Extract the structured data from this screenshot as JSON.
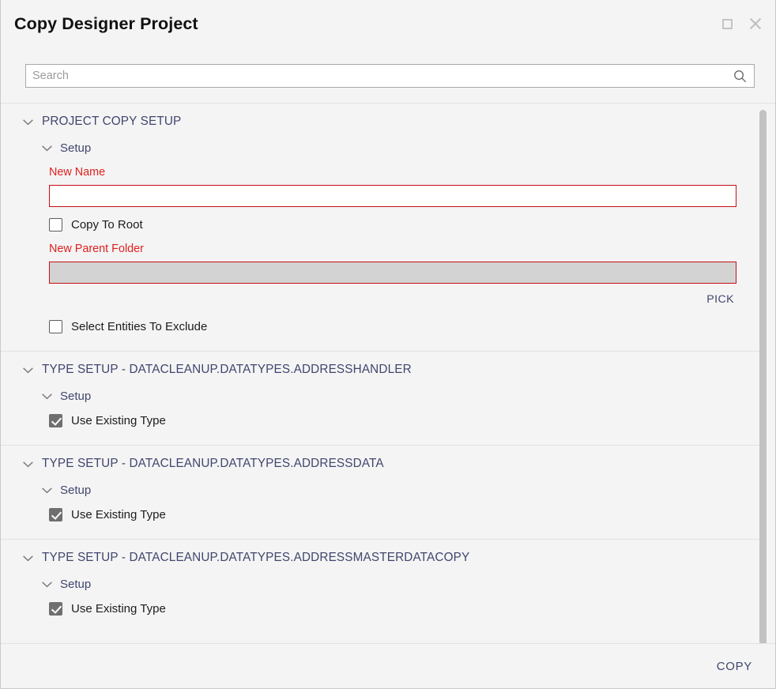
{
  "window": {
    "title": "Copy Designer Project",
    "maximize_icon": "maximize-square-icon",
    "close_icon": "close-x-icon"
  },
  "search": {
    "placeholder": "Search",
    "value": "",
    "icon": "search-icon"
  },
  "colors": {
    "header_blue": "#40466e",
    "required_red": "#e02020",
    "input_error_border": "#c40f16",
    "panel_bg": "#f4f4f4",
    "checkbox_checked": "#6f6f6f",
    "disabled_field": "#d3d3d3"
  },
  "sections": [
    {
      "header": "PROJECT COPY SETUP",
      "subheader": "Setup",
      "fields": {
        "new_name_label": "New Name",
        "new_name_value": "",
        "copy_to_root_label": "Copy To Root",
        "copy_to_root_checked": false,
        "new_parent_folder_label": "New Parent Folder",
        "new_parent_folder_value": "",
        "pick_label": "PICK",
        "select_entities_label": "Select Entities To Exclude",
        "select_entities_checked": false
      }
    },
    {
      "header": "TYPE SETUP - DATACLEANUP.DATATYPES.ADDRESSHANDLER",
      "subheader": "Setup",
      "use_existing_label": "Use Existing Type",
      "use_existing_checked": true
    },
    {
      "header": "TYPE SETUP - DATACLEANUP.DATATYPES.ADDRESSDATA",
      "subheader": "Setup",
      "use_existing_label": "Use Existing Type",
      "use_existing_checked": true
    },
    {
      "header": "TYPE SETUP - DATACLEANUP.DATATYPES.ADDRESSMASTERDATACOPY",
      "subheader": "Setup",
      "use_existing_label": "Use Existing Type",
      "use_existing_checked": true
    }
  ],
  "footer": {
    "copy_label": "COPY"
  }
}
